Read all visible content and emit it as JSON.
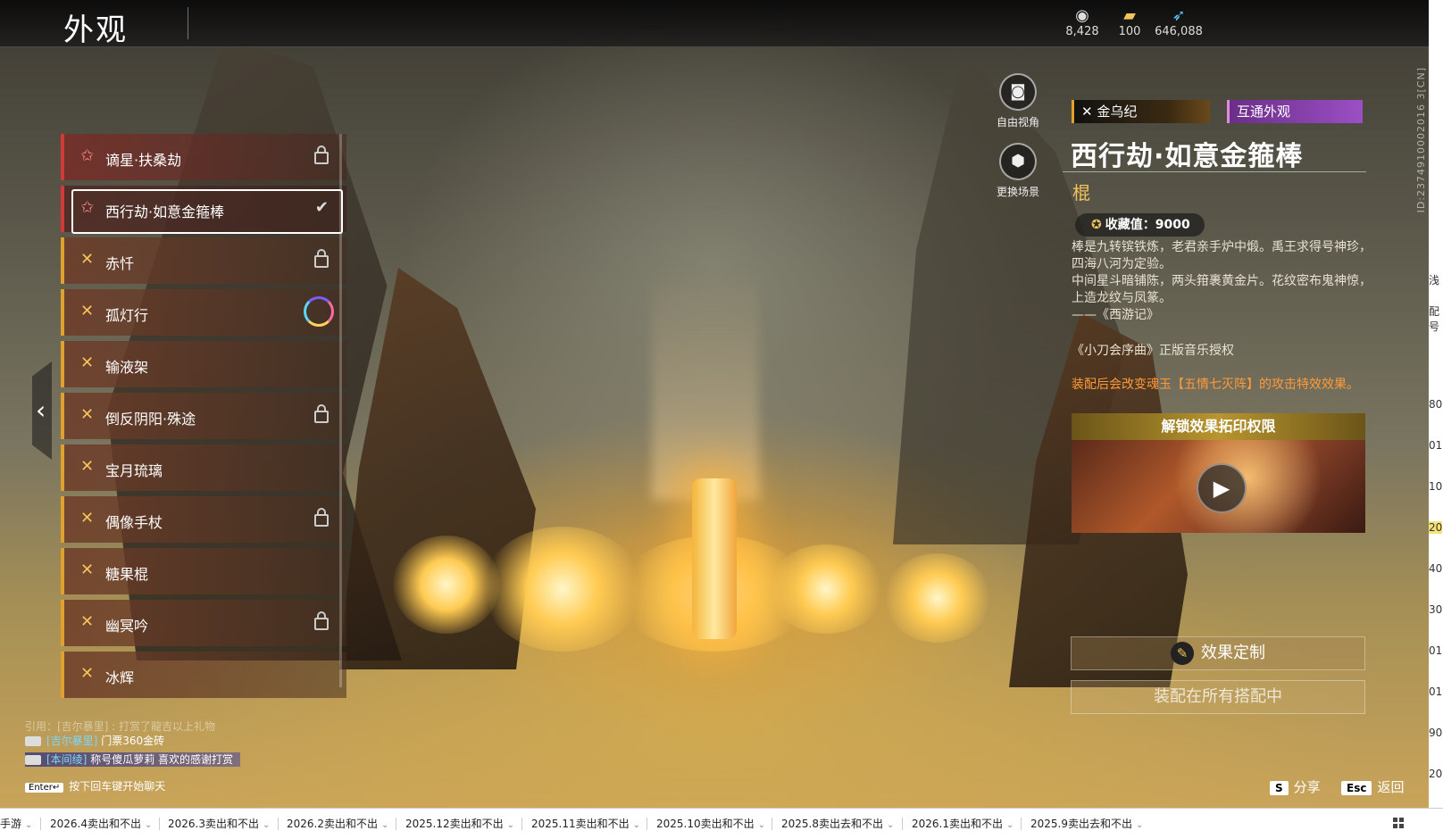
{
  "header": {
    "title": "外观",
    "currencies": [
      {
        "icon": "coin-sack-icon",
        "value": "8,428"
      },
      {
        "icon": "ticket-icon",
        "value": "100"
      },
      {
        "icon": "feather-icon",
        "value": "646,088"
      }
    ]
  },
  "list": {
    "items": [
      {
        "label": "谪星·扶桑劫",
        "state": "locked",
        "tier": "red"
      },
      {
        "label": "西行劫·如意金箍棒",
        "state": "equipped",
        "tier": "red",
        "selected": true
      },
      {
        "label": "赤忏",
        "state": "locked",
        "tier": "gold"
      },
      {
        "label": "孤灯行",
        "state": "progress",
        "tier": "gold"
      },
      {
        "label": "输液架",
        "state": "none",
        "tier": "gold"
      },
      {
        "label": "倒反阴阳·殊途",
        "state": "locked",
        "tier": "gold"
      },
      {
        "label": "宝月琉璃",
        "state": "none",
        "tier": "gold"
      },
      {
        "label": "偶像手杖",
        "state": "locked",
        "tier": "gold"
      },
      {
        "label": "糖果棍",
        "state": "none",
        "tier": "gold"
      },
      {
        "label": "幽冥吟",
        "state": "locked",
        "tier": "gold"
      },
      {
        "label": "冰辉",
        "state": "none",
        "tier": "gold"
      }
    ],
    "check_glyph": "✔",
    "collapse_glyph": "‹"
  },
  "camera": {
    "free_view_label": "自由视角",
    "change_scene_label": "更换场景"
  },
  "detail": {
    "series_tag": "金乌纪",
    "shared_tag": "互通外观",
    "name": "西行劫·如意金箍棒",
    "type": "棍",
    "collect_label": "收藏值：9000",
    "desc_lines": [
      "棒是九转镔铁炼，老君亲手炉中煅。禹王求得号神珍，四海八河为定验。",
      "中间星斗暗铺陈，两头箝裹黄金片。花纹密布鬼神惊，上造龙纹与凤篆。",
      "——《西游记》"
    ],
    "music_note": "《小刀会序曲》正版音乐授权",
    "effect_note": "装配后会改变魂玉【五情七灭阵】的攻击特效效果。",
    "unlock_label": "解锁效果拓印权限",
    "effect_button": "效果定制",
    "equip_button": "装配在所有搭配中",
    "vertical_id": "ID:2374910002016 3[CN]"
  },
  "chat": {
    "quote": "引用：[吉尔暴里] : 打赏了龍吉以上礼物",
    "lines": [
      {
        "who": "[吉尔暴里]",
        "text": "门票360金砖"
      },
      {
        "who": "[本间绫]",
        "text": "称号傻瓜萝莉 喜欢的感谢打赏"
      }
    ],
    "enter_key": "Enter↵",
    "hint": "按下回车键开始聊天"
  },
  "hotkeys": {
    "share_key": "S",
    "share_label": "分享",
    "back_key": "Esc",
    "back_label": "返回"
  },
  "strip": [
    "浅",
    "配号",
    "80",
    "01",
    "10",
    "20",
    "40",
    "30",
    "01",
    "01",
    "90",
    "20"
  ],
  "tabs": [
    "手游",
    "2026.4卖出和不出",
    "2026.3卖出和不出",
    "2026.2卖出和不出",
    "2025.12卖出和不出",
    "2025.11卖出和不出",
    "2025.10卖出和不出",
    "2025.8卖出去和不出",
    "2026.1卖出和不出",
    "2025.9卖出去和不出"
  ],
  "colors": {
    "gold": "#e0a22c",
    "red": "#d23a3a",
    "accent_orange": "#ff9a3a",
    "purple_tag": "#9b4fc4"
  }
}
